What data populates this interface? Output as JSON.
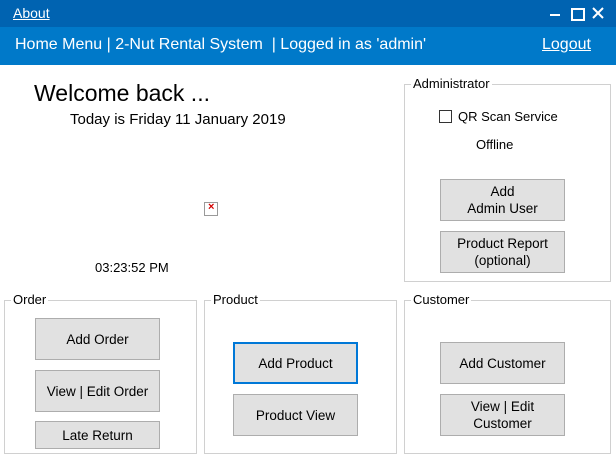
{
  "window": {
    "about_label": "About",
    "header_title": "Home Menu | 2-Nut Rental System  | Logged in as 'admin'",
    "logout_label": "Logout"
  },
  "home": {
    "welcome": "Welcome back ...",
    "date_text": "Today is Friday 11 January 2019",
    "time_text": "03:23:52 PM"
  },
  "administrator": {
    "group_label": "Administrator",
    "qr_label": "QR Scan Service",
    "qr_checked": false,
    "qr_status": "Offline",
    "add_admin_label": "Add\nAdmin User",
    "product_report_label": "Product Report\n(optional)"
  },
  "order": {
    "group_label": "Order",
    "add_label": "Add Order",
    "view_edit_label": "View | Edit Order",
    "late_return_label": "Late Return"
  },
  "product": {
    "group_label": "Product",
    "add_label": "Add Product",
    "view_label": "Product View"
  },
  "customer": {
    "group_label": "Customer",
    "add_label": "Add Customer",
    "view_edit_label": "View | Edit\nCustomer"
  },
  "colors": {
    "titlebar": "#0063b1",
    "header": "#0079c9",
    "focus_border": "#0078d7"
  },
  "icons": [
    "minimize-icon",
    "maximize-icon",
    "close-icon",
    "broken-image-icon"
  ]
}
